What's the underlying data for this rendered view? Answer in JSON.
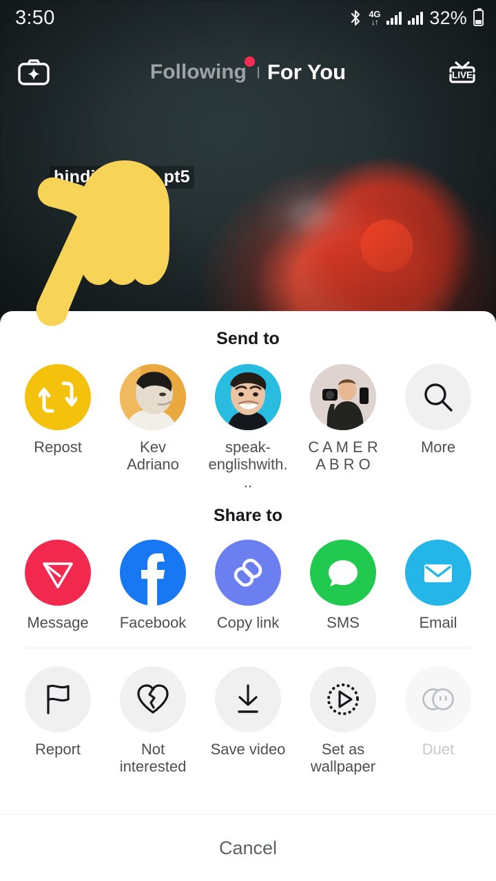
{
  "status_bar": {
    "time": "3:50",
    "bluetooth_icon": "bluetooth-icon",
    "network_type": "4G",
    "network_arrows": "↓↑",
    "battery_percent": "32%",
    "battery_icon": "battery-icon",
    "signal_icon": "signal-bars-icon"
  },
  "top_nav": {
    "camera_icon": "camera-effects-icon",
    "tab_following": "Following",
    "tab_following_has_dot": true,
    "notification_dot_color": "#fe2c55",
    "tab_for_you": "For You",
    "active_tab": "For You",
    "live_icon": "live-tv-icon",
    "live_label": "LIVE"
  },
  "video": {
    "caption": "hindi a… ras pt5",
    "pointer_icon": "pointing-hand-cursor",
    "pointer_color": "#f7d358"
  },
  "sheet": {
    "send_to": {
      "title": "Send to",
      "items": [
        {
          "label": "Repost",
          "icon": "repost-icon",
          "kind": "action",
          "color": "#f4c20d",
          "disabled": false
        },
        {
          "label": "Kev Adriano",
          "icon": "avatar",
          "kind": "contact",
          "color": "#e8a13c",
          "disabled": false
        },
        {
          "label": "speak-englishwith...",
          "icon": "avatar",
          "kind": "contact",
          "color": "#27bce0",
          "disabled": false
        },
        {
          "label": "C A M E R A B R O",
          "icon": "avatar",
          "kind": "contact",
          "color": "#ded2cf",
          "disabled": false
        },
        {
          "label": "More",
          "icon": "search-icon",
          "kind": "action",
          "color": "#f0f0f1",
          "disabled": false
        }
      ]
    },
    "share_to": {
      "title": "Share to",
      "items": [
        {
          "label": "Message",
          "icon": "tiktok-message-icon",
          "color": "#f3284e",
          "disabled": false
        },
        {
          "label": "Facebook",
          "icon": "facebook-icon",
          "color": "#1877f2",
          "disabled": false
        },
        {
          "label": "Copy link",
          "icon": "link-icon",
          "color": "#6b7ff0",
          "disabled": false
        },
        {
          "label": "SMS",
          "icon": "sms-bubble-icon",
          "color": "#25d366",
          "disabled": false
        },
        {
          "label": "Email",
          "icon": "email-envelope-icon",
          "color": "#24b6e8",
          "disabled": false
        }
      ]
    },
    "actions": [
      {
        "label": "Report",
        "icon": "flag-icon",
        "disabled": false
      },
      {
        "label": "Not interested",
        "icon": "broken-heart-icon",
        "disabled": false
      },
      {
        "label": "Save video",
        "icon": "download-icon",
        "disabled": false
      },
      {
        "label": "Set as wallpaper",
        "icon": "play-dotted-circle-icon",
        "disabled": false
      },
      {
        "label": "Duet",
        "icon": "duet-icon",
        "disabled": true
      }
    ],
    "cancel_label": "Cancel"
  }
}
